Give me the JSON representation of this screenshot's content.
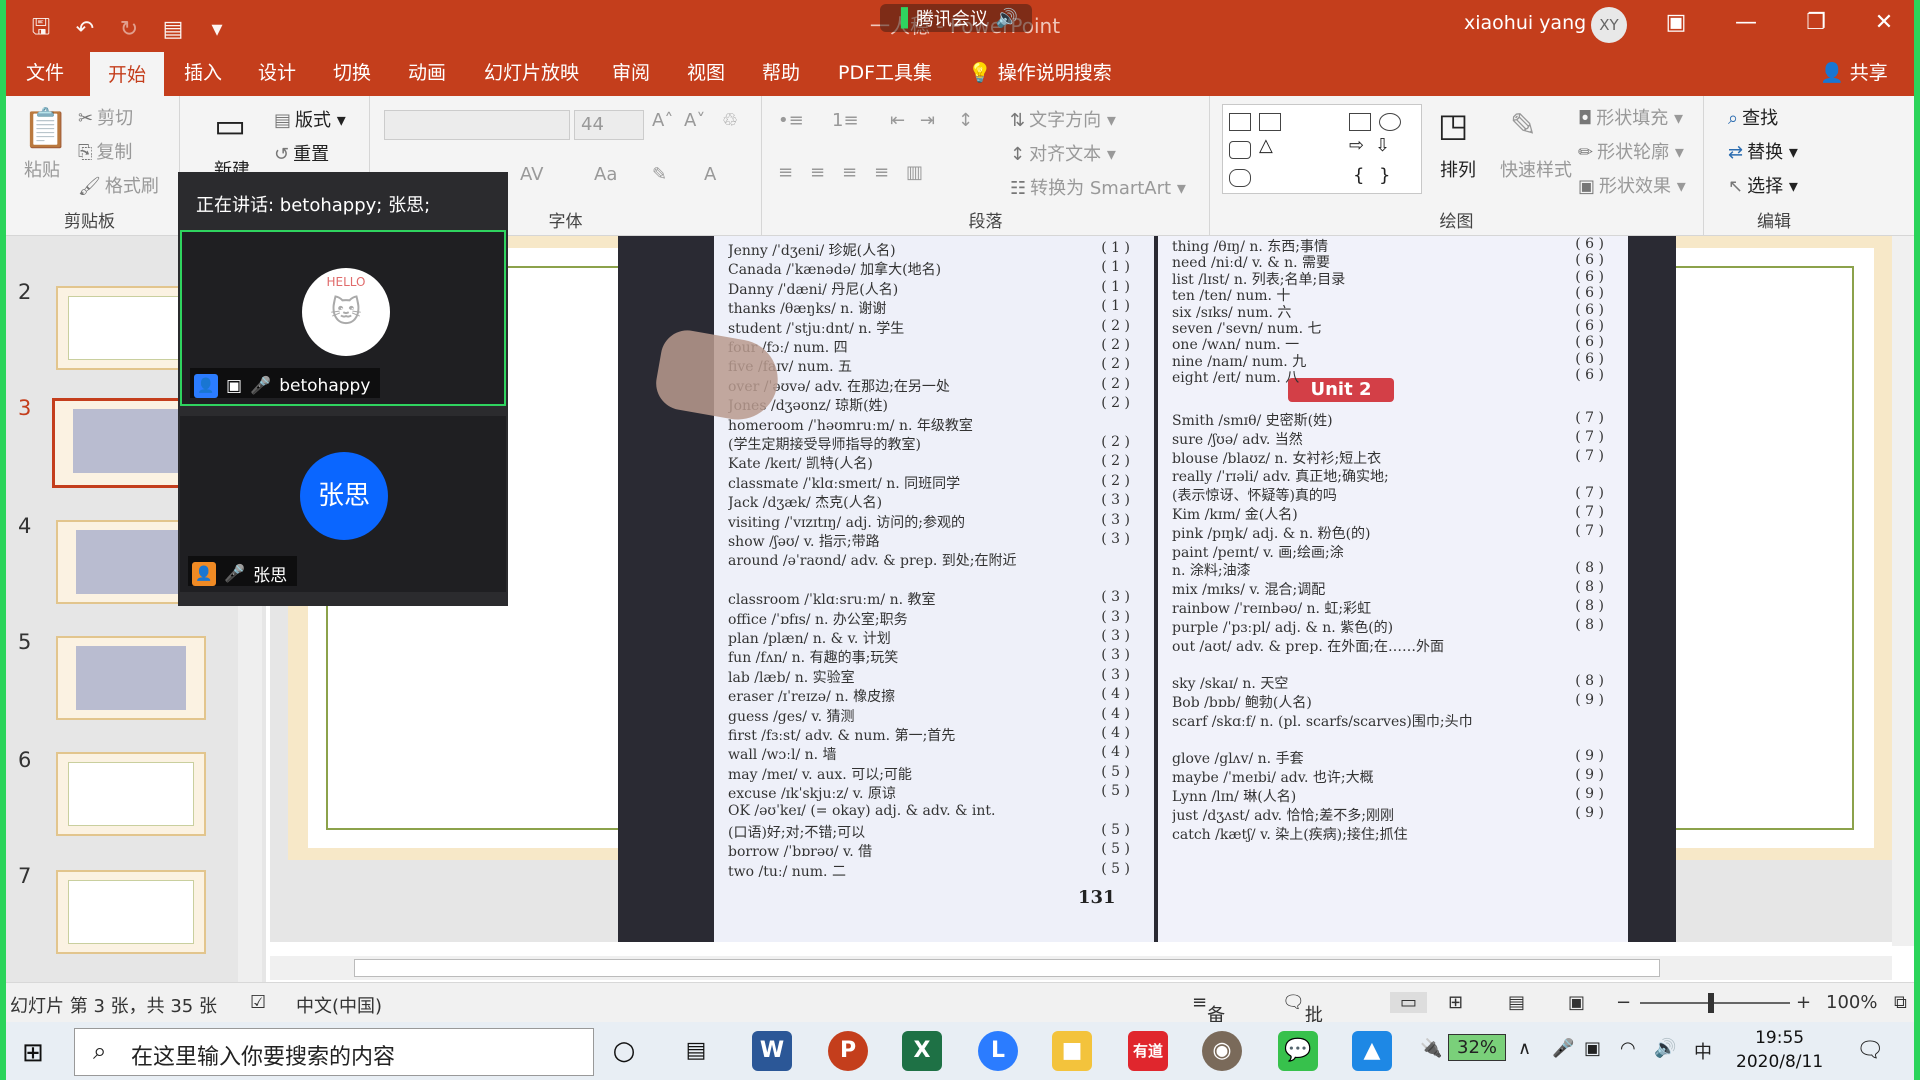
{
  "window": {
    "title": "一人稳 - PowerPoint",
    "meeting_app": "腾讯会议",
    "user_name": "xiaohui yang",
    "user_initials": "XY"
  },
  "tabs": [
    "文件",
    "开始",
    "插入",
    "设计",
    "切换",
    "动画",
    "幻灯片放映",
    "审阅",
    "视图",
    "帮助",
    "PDF工具集"
  ],
  "active_tab": "开始",
  "tell_me": "操作说明搜索",
  "share": "共享",
  "ribbon": {
    "clipboard": {
      "paste": "粘贴",
      "cut": "剪切",
      "copy": "复制",
      "format_painter": "格式刷",
      "label": "剪贴板"
    },
    "slides": {
      "new": "新建",
      "layout": "版式",
      "reset": "重置"
    },
    "font": {
      "size": "44",
      "label": "字体"
    },
    "paragraph": {
      "text_direction": "文字方向",
      "align_text": "对齐文本",
      "smartart": "转换为 SmartArt",
      "label": "段落"
    },
    "drawing": {
      "arrange": "排列",
      "quick_styles": "快速样式",
      "fill": "形状填充",
      "outline": "形状轮廓",
      "effects": "形状效果",
      "label": "绘图"
    },
    "editing": {
      "find": "查找",
      "replace": "替换",
      "select": "选择",
      "label": "编辑"
    }
  },
  "thumbnails": [
    "2",
    "3",
    "4",
    "5",
    "6",
    "7"
  ],
  "selected_slide": "3",
  "meeting": {
    "speaking": "正在讲话: betohappy; 张思;",
    "p1_name": "betohappy",
    "p2_name": "张思",
    "p1_avatar_text": "HELLO",
    "p2_avatar_text": "张思"
  },
  "book": {
    "unit_label": "Unit 2",
    "page_number": "131",
    "left_rows": [
      [
        "Jenny /ˈdʒeni/ 珍妮(人名)",
        "( 1 )"
      ],
      [
        "Canada /ˈkænədə/ 加拿大(地名)",
        "( 1 )"
      ],
      [
        "Danny /ˈdæni/ 丹尼(人名)",
        "( 1 )"
      ],
      [
        "thanks /θæŋks/ n. 谢谢",
        "( 1 )"
      ],
      [
        "student /ˈstjuːdnt/ n. 学生",
        "( 2 )"
      ],
      [
        "four /fɔː/ num. 四",
        "( 2 )"
      ],
      [
        "five /faɪv/ num. 五",
        "( 2 )"
      ],
      [
        "over /ˈəʊvə/ adv. 在那边;在另一处",
        "( 2 )"
      ],
      [
        "Jones /dʒəʊnz/ 琼斯(姓)",
        "( 2 )"
      ],
      [
        "homeroom /ˈhəʊmruːm/ n. 年级教室",
        ""
      ],
      [
        "(学生定期接受导师指导的教室)",
        "( 2 )"
      ],
      [
        "Kate /keɪt/ 凯特(人名)",
        "( 2 )"
      ],
      [
        "classmate /ˈklɑːsmeɪt/ n. 同班同学",
        "( 2 )"
      ],
      [
        "Jack /dʒæk/ 杰克(人名)",
        "( 3 )"
      ],
      [
        "visiting /ˈvɪzɪtɪŋ/ adj. 访问的;参观的",
        "( 3 )"
      ],
      [
        "show /ʃəʊ/ v. 指示;带路",
        "( 3 )"
      ],
      [
        "around /əˈraʊnd/ adv. & prep. 到处;在附近",
        ""
      ],
      [
        "",
        "( 3 )"
      ],
      [
        "classroom /ˈklɑːsruːm/ n. 教室",
        "( 3 )"
      ],
      [
        "office /ˈɒfɪs/ n. 办公室;职务",
        "( 3 )"
      ],
      [
        "plan /plæn/ n. & v. 计划",
        "( 3 )"
      ],
      [
        "fun /fʌn/ n. 有趣的事;玩笑",
        "( 3 )"
      ],
      [
        "lab /læb/ n. 实验室",
        "( 3 )"
      ],
      [
        "eraser /ɪˈreɪzə/ n. 橡皮擦",
        "( 4 )"
      ],
      [
        "guess /ges/ v. 猜测",
        "( 4 )"
      ],
      [
        "first /fɜːst/ adv. & num. 第一;首先",
        "( 4 )"
      ],
      [
        "wall /wɔːl/ n. 墙",
        "( 4 )"
      ],
      [
        "may /meɪ/ v. aux. 可以;可能",
        "( 5 )"
      ],
      [
        "excuse /ɪkˈskjuːz/ v. 原谅",
        "( 5 )"
      ],
      [
        "OK /əʊˈkeɪ/ (= okay) adj. & adv. & int.",
        ""
      ],
      [
        "(口语)好;对;不错;可以",
        "( 5 )"
      ],
      [
        "borrow /ˈbɒrəʊ/ v. 借",
        "( 5 )"
      ],
      [
        "two /tuː/ num. 二",
        "( 5 )"
      ]
    ],
    "right_rows_top": [
      [
        "thing /θɪŋ/ n. 东西;事情",
        "( 6 )"
      ],
      [
        "need /niːd/ v. & n. 需要",
        "( 6 )"
      ],
      [
        "list /lɪst/ n. 列表;名单;目录",
        "( 6 )"
      ],
      [
        "ten /ten/ num. 十",
        "( 6 )"
      ],
      [
        "six /sɪks/ num. 六",
        "( 6 )"
      ],
      [
        "seven /ˈsevn/ num. 七",
        "( 6 )"
      ],
      [
        "one /wʌn/ num. 一",
        "( 6 )"
      ],
      [
        "nine /naɪn/ num. 九",
        "( 6 )"
      ],
      [
        "eight /eɪt/ num. 八",
        "( 6 )"
      ]
    ],
    "right_rows_bottom": [
      [
        "Smith /smɪθ/ 史密斯(姓)",
        "( 7 )"
      ],
      [
        "sure /ʃʊə/ adv. 当然",
        "( 7 )"
      ],
      [
        "blouse /blaʊz/ n. 女衬衫;短上衣",
        "( 7 )"
      ],
      [
        "really /ˈrɪəli/ adv. 真正地;确实地;",
        ""
      ],
      [
        "(表示惊讶、怀疑等)真的吗",
        "( 7 )"
      ],
      [
        "Kim /kɪm/ 金(人名)",
        "( 7 )"
      ],
      [
        "pink /pɪŋk/ adj. & n. 粉色(的)",
        "( 7 )"
      ],
      [
        "paint /peɪnt/ v. 画;绘画;涂",
        ""
      ],
      [
        "n. 涂料;油漆",
        "( 8 )"
      ],
      [
        "mix /mɪks/ v. 混合;调配",
        "( 8 )"
      ],
      [
        "rainbow /ˈreɪnbəʊ/ n. 虹;彩虹",
        "( 8 )"
      ],
      [
        "purple /ˈpɜːpl/ adj. & n. 紫色(的)",
        "( 8 )"
      ],
      [
        "out /aʊt/ adv. & prep. 在外面;在……外面",
        ""
      ],
      [
        "",
        "( 8 )"
      ],
      [
        "sky /skaɪ/ n. 天空",
        "( 8 )"
      ],
      [
        "Bob /bɒb/ 鲍勃(人名)",
        "( 9 )"
      ],
      [
        "scarf /skɑːf/ n. (pl. scarfs/scarves)围巾;头巾",
        ""
      ],
      [
        "",
        "( 9 )"
      ],
      [
        "glove /glʌv/ n. 手套",
        "( 9 )"
      ],
      [
        "maybe /ˈmeɪbi/ adv. 也许;大概",
        "( 9 )"
      ],
      [
        "Lynn /lɪn/ 琳(人名)",
        "( 9 )"
      ],
      [
        "just /dʒʌst/ adv. 恰恰;差不多;刚刚",
        "( 9 )"
      ],
      [
        "catch /kætʃ/ v. 染上(疾病);接住;抓住",
        ""
      ]
    ]
  },
  "statusbar": {
    "slide_info": "幻灯片 第 3 张，共 35 张",
    "language": "中文(中国)",
    "notes": "备注",
    "comments": "批注",
    "zoom": "100%"
  },
  "taskbar": {
    "search_placeholder": "在这里输入你要搜索的内容",
    "battery": "32%",
    "ime": "中",
    "time": "19:55",
    "date": "2020/8/11"
  }
}
